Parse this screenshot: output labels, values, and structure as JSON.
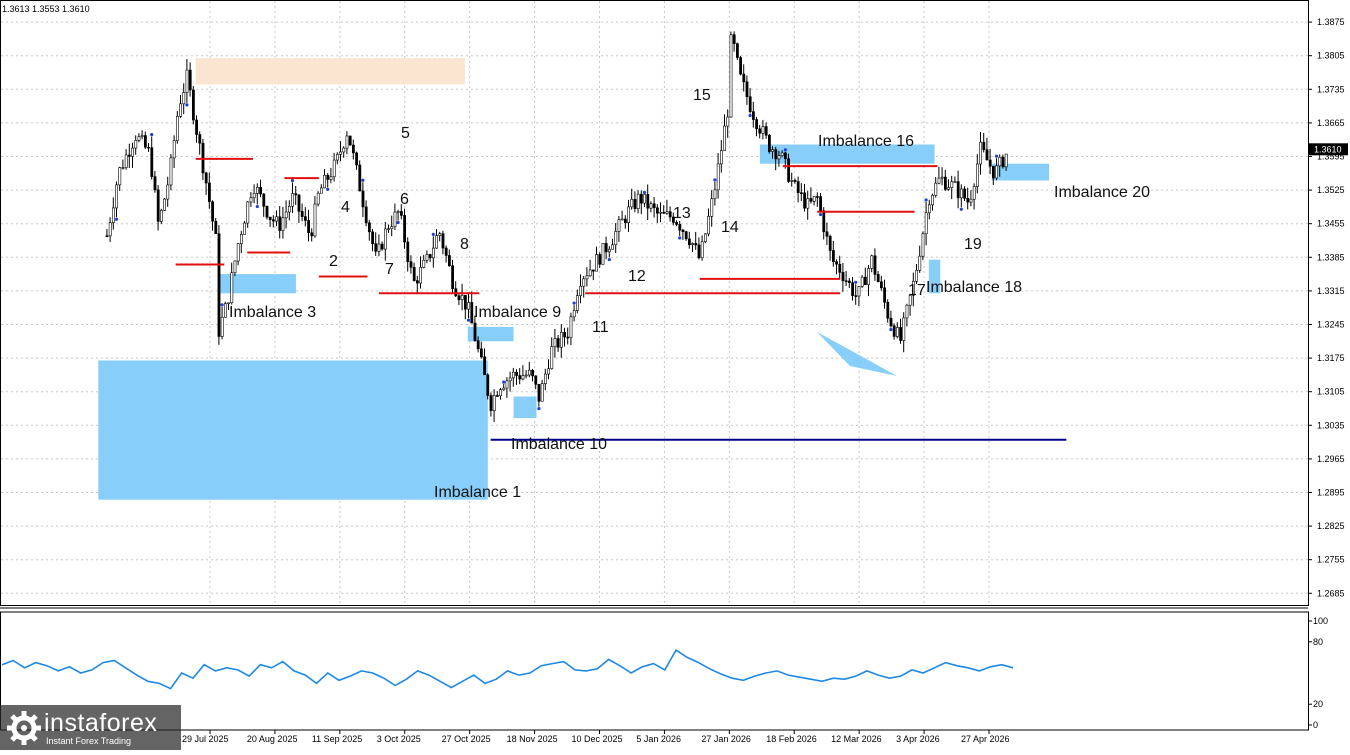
{
  "header": {
    "ohlc": "1.3613 1.3553 1.3610"
  },
  "price_axis": {
    "labels": [
      "1.3875",
      "1.3805",
      "1.3735",
      "1.3665",
      "1.3595",
      "1.3525",
      "1.3455",
      "1.3385",
      "1.3315",
      "1.3245",
      "1.3175",
      "1.3105",
      "1.3035",
      "1.2965",
      "1.2895",
      "1.2825",
      "1.2755",
      "1.2685"
    ],
    "current": "1.3610"
  },
  "time_axis": {
    "labels": [
      "29 Jul 2025",
      "20 Aug 2025",
      "11 Sep 2025",
      "3 Oct 2025",
      "27 Oct 2025",
      "18 Nov 2025",
      "10 Dec 2025",
      "5 Jan 2026",
      "27 Jan 2026",
      "18 Feb 2026",
      "12 Mar 2026",
      "3 Apr 2026",
      "27 Apr 2026"
    ]
  },
  "indicator_axis": {
    "labels": [
      "100",
      "80",
      "20",
      "0"
    ]
  },
  "labels": {
    "imb1": "Imbalance 1",
    "imb3": "Imbalance 3",
    "imb9": "Imbalance 9",
    "imb10": "Imbalance 10",
    "imb16": "Imbalance 16",
    "imb18": "Imbalance 18",
    "imb20": "Imbalance 20",
    "n2": "2",
    "n4": "4",
    "n5": "5",
    "n6": "6",
    "n7": "7",
    "n8": "8",
    "n11": "11",
    "n12": "12",
    "n13": "13",
    "n14": "14",
    "n15": "15",
    "n17": "17",
    "n19": "19"
  },
  "watermark": {
    "brand": "instaforex",
    "tagline": "Instant Forex Trading"
  },
  "colors": {
    "zone": "#87cefa",
    "supply": "#fae5d0",
    "level_red": "#e01010",
    "level_blue": "#00008b",
    "candle": "#000000",
    "oscillator": "#1e88e5",
    "marker": "#1f3fd6"
  },
  "chart_data": [
    {
      "type": "candlestick",
      "symbol_ohlc": "1.3613 1.3553 1.3610",
      "x_labels": [
        "29 Jul 2025",
        "20 Aug 2025",
        "11 Sep 2025",
        "3 Oct 2025",
        "27 Oct 2025",
        "18 Nov 2025",
        "10 Dec 2025",
        "5 Jan 2026",
        "27 Jan 2026",
        "18 Feb 2026",
        "12 Mar 2026",
        "3 Apr 2026",
        "27 Apr 2026"
      ],
      "ylim": [
        1.2675,
        1.3895
      ],
      "last_price": 1.361,
      "close_path": [
        {
          "date": "2025-06-23",
          "close": 1.343
        },
        {
          "date": "2025-06-27",
          "close": 1.356
        },
        {
          "date": "2025-07-03",
          "close": 1.364
        },
        {
          "date": "2025-07-08",
          "close": 1.36
        },
        {
          "date": "2025-07-11",
          "close": 1.345
        },
        {
          "date": "2025-07-15",
          "close": 1.356
        },
        {
          "date": "2025-07-18",
          "close": 1.37
        },
        {
          "date": "2025-07-21",
          "close": 1.376
        },
        {
          "date": "2025-07-24",
          "close": 1.366
        },
        {
          "date": "2025-07-28",
          "close": 1.353
        },
        {
          "date": "2025-07-31",
          "close": 1.342
        },
        {
          "date": "2025-08-01",
          "close": 1.323
        },
        {
          "date": "2025-08-04",
          "close": 1.329
        },
        {
          "date": "2025-08-08",
          "close": 1.342
        },
        {
          "date": "2025-08-13",
          "close": 1.354
        },
        {
          "date": "2025-08-19",
          "close": 1.347
        },
        {
          "date": "2025-08-22",
          "close": 1.345
        },
        {
          "date": "2025-08-27",
          "close": 1.351
        },
        {
          "date": "2025-09-02",
          "close": 1.343
        },
        {
          "date": "2025-09-05",
          "close": 1.352
        },
        {
          "date": "2025-09-11",
          "close": 1.358
        },
        {
          "date": "2025-09-15",
          "close": 1.365
        },
        {
          "date": "2025-09-19",
          "close": 1.354
        },
        {
          "date": "2025-09-25",
          "close": 1.338
        },
        {
          "date": "2025-09-29",
          "close": 1.345
        },
        {
          "date": "2025-10-03",
          "close": 1.348
        },
        {
          "date": "2025-10-08",
          "close": 1.333
        },
        {
          "date": "2025-10-13",
          "close": 1.338
        },
        {
          "date": "2025-10-17",
          "close": 1.344
        },
        {
          "date": "2025-10-22",
          "close": 1.333
        },
        {
          "date": "2025-10-27",
          "close": 1.328
        },
        {
          "date": "2025-11-04",
          "close": 1.308
        },
        {
          "date": "2025-11-07",
          "close": 1.312
        },
        {
          "date": "2025-11-12",
          "close": 1.314
        },
        {
          "date": "2025-11-18",
          "close": 1.314
        },
        {
          "date": "2025-11-21",
          "close": 1.309
        },
        {
          "date": "2025-11-25",
          "close": 1.319
        },
        {
          "date": "2025-12-01",
          "close": 1.323
        },
        {
          "date": "2025-12-05",
          "close": 1.334
        },
        {
          "date": "2025-12-10",
          "close": 1.337
        },
        {
          "date": "2025-12-16",
          "close": 1.342
        },
        {
          "date": "2025-12-22",
          "close": 1.348
        },
        {
          "date": "2025-12-26",
          "close": 1.351
        },
        {
          "date": "2026-01-02",
          "close": 1.347
        },
        {
          "date": "2026-01-07",
          "close": 1.347
        },
        {
          "date": "2026-01-13",
          "close": 1.342
        },
        {
          "date": "2026-01-16",
          "close": 1.338
        },
        {
          "date": "2026-01-21",
          "close": 1.352
        },
        {
          "date": "2026-01-26",
          "close": 1.37
        },
        {
          "date": "2026-01-27",
          "close": 1.385
        },
        {
          "date": "2026-01-30",
          "close": 1.376
        },
        {
          "date": "2026-02-04",
          "close": 1.368
        },
        {
          "date": "2026-02-09",
          "close": 1.362
        },
        {
          "date": "2026-02-13",
          "close": 1.36
        },
        {
          "date": "2026-02-18",
          "close": 1.353
        },
        {
          "date": "2026-02-23",
          "close": 1.349
        },
        {
          "date": "2026-02-26",
          "close": 1.351
        },
        {
          "date": "2026-03-03",
          "close": 1.338
        },
        {
          "date": "2026-03-06",
          "close": 1.336
        },
        {
          "date": "2026-03-12",
          "close": 1.33
        },
        {
          "date": "2026-03-17",
          "close": 1.338
        },
        {
          "date": "2026-03-23",
          "close": 1.326
        },
        {
          "date": "2026-03-27",
          "close": 1.321
        },
        {
          "date": "2026-04-01",
          "close": 1.334
        },
        {
          "date": "2026-04-06",
          "close": 1.351
        },
        {
          "date": "2026-04-10",
          "close": 1.355
        },
        {
          "date": "2026-04-15",
          "close": 1.353
        },
        {
          "date": "2026-04-20",
          "close": 1.35
        },
        {
          "date": "2026-04-24",
          "close": 1.361
        },
        {
          "date": "2026-04-29",
          "close": 1.356
        },
        {
          "date": "2026-05-04",
          "close": 1.361
        }
      ],
      "zones": [
        {
          "name": "Imbalance 1",
          "kind": "bullish_imbalance",
          "from": "2025-06-20",
          "to": "2025-11-03",
          "high": 1.317,
          "low": 1.288
        },
        {
          "name": "Imbalance 3",
          "kind": "bullish_imbalance",
          "from": "2025-08-01",
          "to": "2025-08-28",
          "high": 1.335,
          "low": 1.331
        },
        {
          "name": "Imbalance 9",
          "kind": "bullish_imbalance",
          "from": "2025-10-27",
          "to": "2025-11-12",
          "high": 1.324,
          "low": 1.321
        },
        {
          "name": "Imbalance 10",
          "kind": "bullish_imbalance",
          "from": "2025-11-12",
          "to": "2025-11-20",
          "high": 1.3095,
          "low": 1.305
        },
        {
          "name": "Imbalance 16",
          "kind": "bullish_imbalance",
          "from": "2026-02-06",
          "to": "2026-04-08",
          "high": 1.362,
          "low": 1.358
        },
        {
          "name": "Imbalance 18",
          "kind": "bullish_imbalance",
          "from": "2026-04-06",
          "to": "2026-04-10",
          "high": 1.338,
          "low": 1.331
        },
        {
          "name": "Imbalance 20",
          "kind": "bullish_imbalance",
          "from": "2026-04-28",
          "to": "2026-05-18",
          "high": 1.358,
          "low": 1.3545
        },
        {
          "name": "supply",
          "kind": "bearish_zone",
          "from": "2025-07-24",
          "to": "2025-10-26",
          "high": 1.38,
          "low": 1.3745
        }
      ],
      "levels": [
        {
          "color": "red",
          "price": 1.337,
          "from": "2025-07-17",
          "to": "2025-08-03"
        },
        {
          "color": "red",
          "price": 1.359,
          "from": "2025-07-24",
          "to": "2025-08-13"
        },
        {
          "color": "red",
          "price": 1.3395,
          "from": "2025-08-11",
          "to": "2025-08-26"
        },
        {
          "color": "red",
          "price": 1.355,
          "from": "2025-08-24",
          "to": "2025-09-05"
        },
        {
          "color": "red",
          "price": 1.3345,
          "from": "2025-09-05",
          "to": "2025-09-22"
        },
        {
          "color": "red",
          "price": 1.331,
          "from": "2025-09-26",
          "to": "2025-10-31"
        },
        {
          "color": "red",
          "price": 1.331,
          "from": "2025-12-07",
          "to": "2026-03-06"
        },
        {
          "color": "red",
          "price": 1.334,
          "from": "2026-01-16",
          "to": "2026-03-06"
        },
        {
          "color": "red",
          "price": 1.3575,
          "from": "2026-02-14",
          "to": "2026-04-09"
        },
        {
          "color": "red",
          "price": 1.348,
          "from": "2026-02-26",
          "to": "2026-04-01"
        },
        {
          "color": "blue",
          "price": 1.3005,
          "from": "2025-11-04",
          "to": "2026-05-24"
        }
      ]
    },
    {
      "type": "line",
      "name": "oscillator",
      "ylim": [
        0,
        100
      ],
      "ticks": [
        100,
        80,
        20,
        0
      ],
      "values": [
        58,
        62,
        55,
        60,
        57,
        52,
        56,
        50,
        53,
        60,
        62,
        55,
        48,
        42,
        40,
        35,
        50,
        45,
        58,
        52,
        55,
        53,
        47,
        58,
        55,
        61,
        52,
        48,
        40,
        50,
        43,
        47,
        52,
        50,
        45,
        38,
        44,
        52,
        48,
        42,
        36,
        42,
        48,
        40,
        44,
        52,
        48,
        50,
        57,
        59,
        61,
        53,
        52,
        54,
        63,
        57,
        50,
        56,
        59,
        53,
        72,
        65,
        60,
        54,
        49,
        45,
        43,
        47,
        50,
        52,
        48,
        46,
        44,
        42,
        45,
        44,
        47,
        52,
        48,
        45,
        47,
        53,
        50,
        55,
        60,
        57,
        55,
        52,
        56,
        58,
        55
      ]
    }
  ]
}
